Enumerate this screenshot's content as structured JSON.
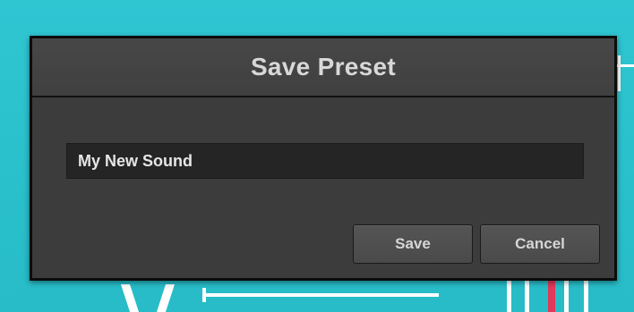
{
  "dialog": {
    "title": "Save Preset",
    "name_value": "My New Sound",
    "save_label": "Save",
    "cancel_label": "Cancel"
  },
  "colors": {
    "backdrop": "#2cc3cf",
    "dialog_bg": "#3c3c3c",
    "input_bg": "#252525",
    "accent_line": "#e0395a"
  }
}
